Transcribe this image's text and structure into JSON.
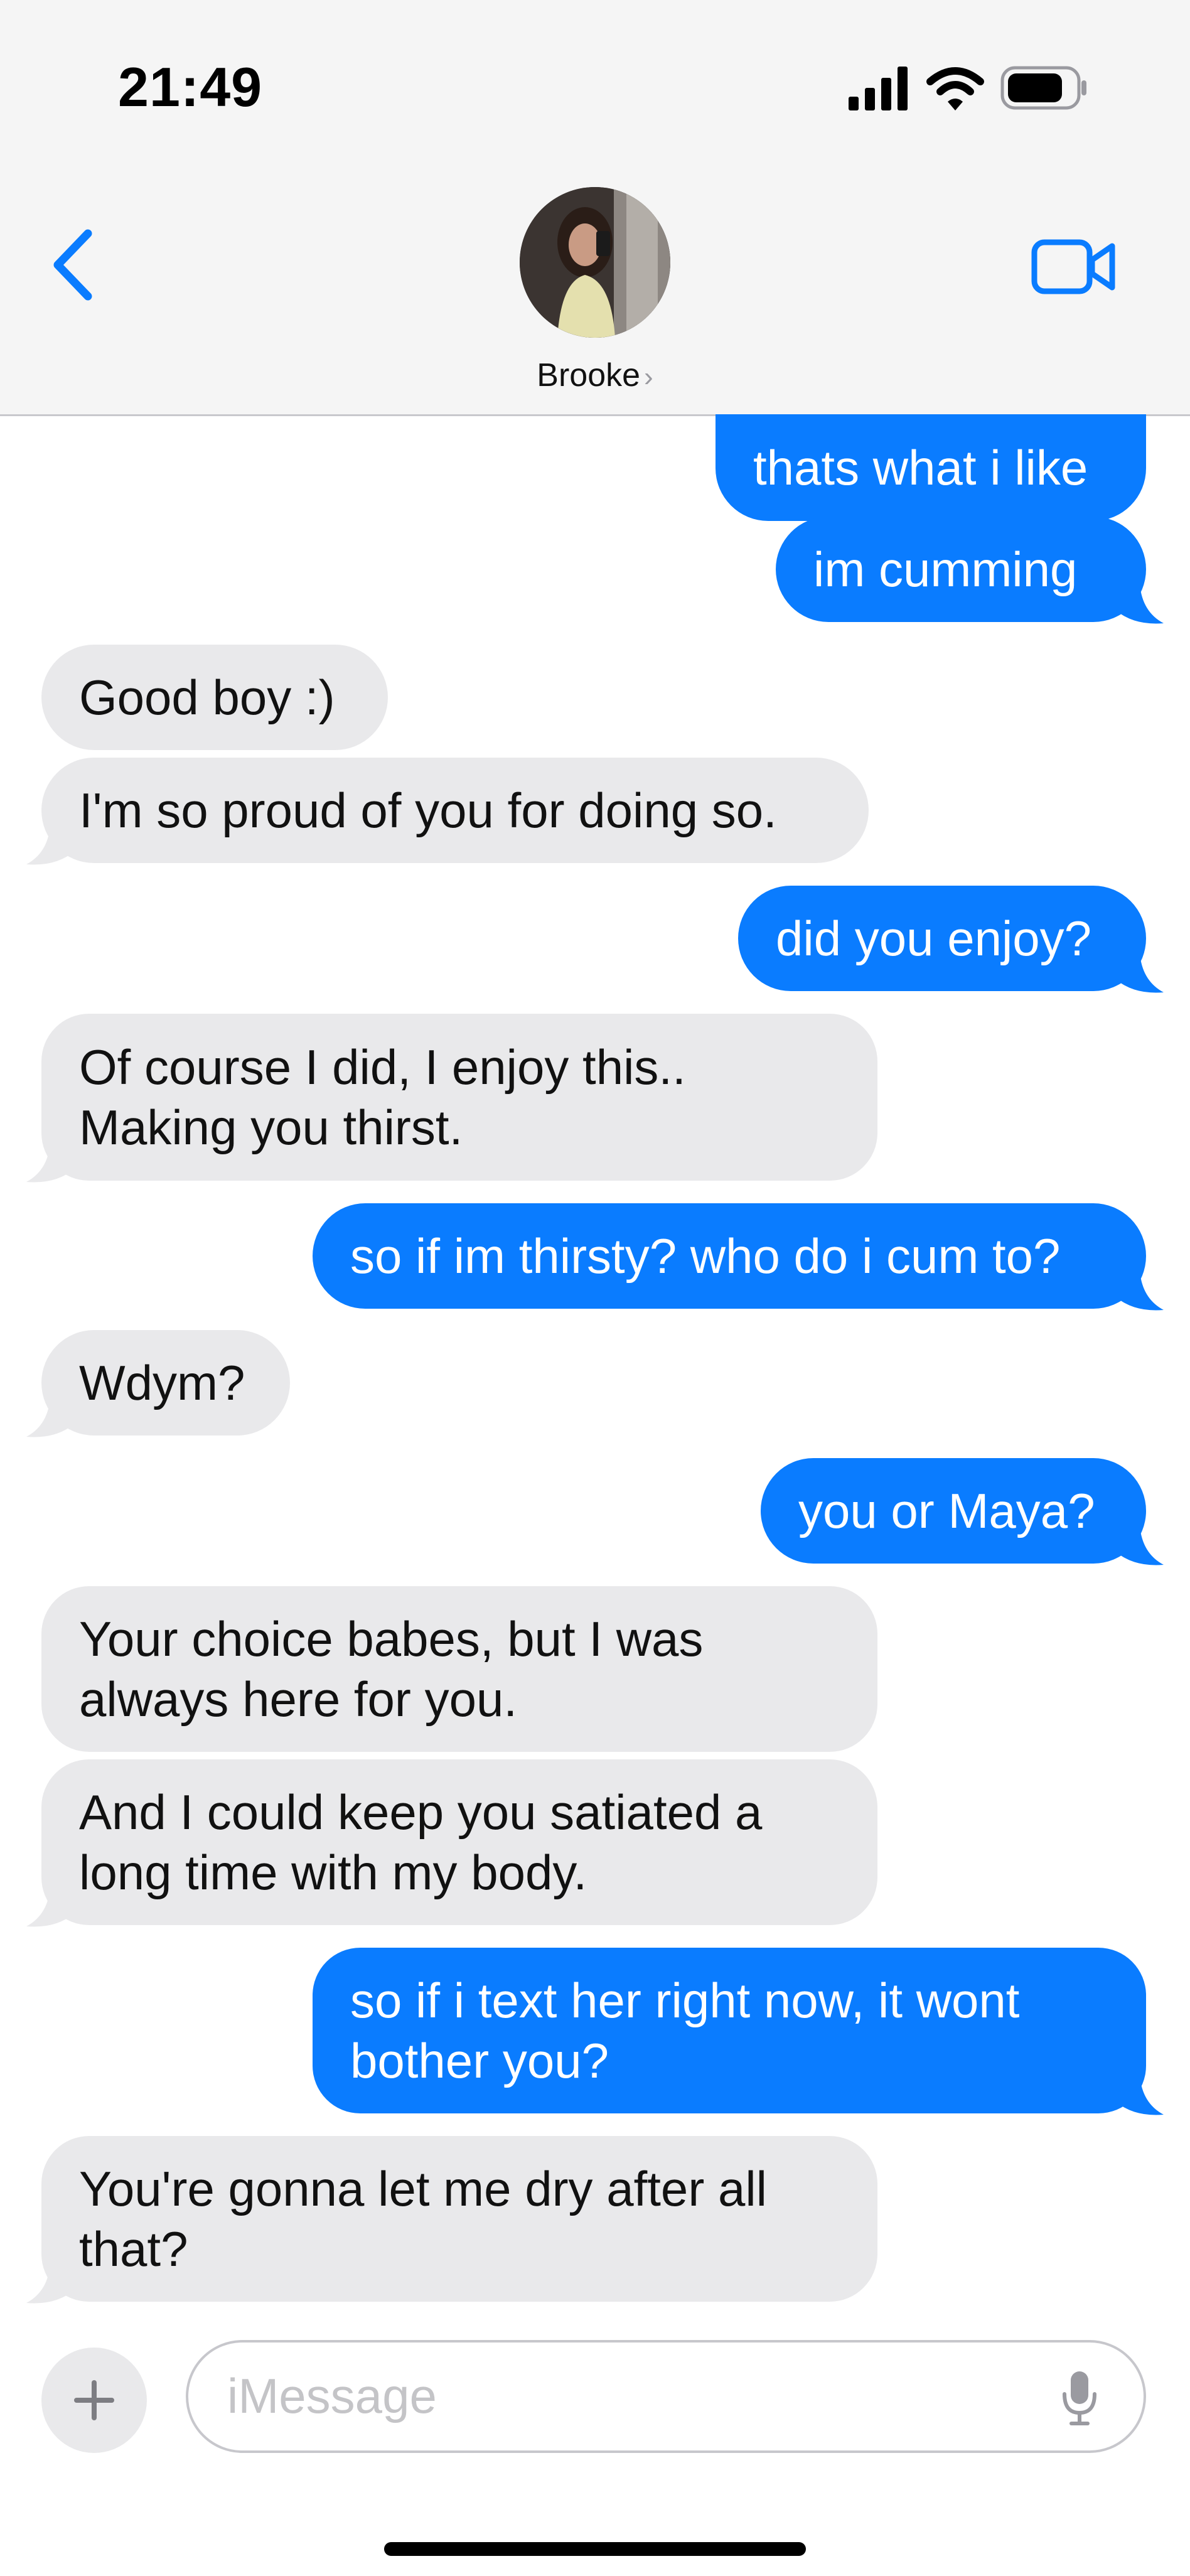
{
  "status_bar": {
    "time": "21:49"
  },
  "header": {
    "contact_name": "Brooke",
    "chevron": "›"
  },
  "icons": [
    "signal-icon",
    "wifi-icon",
    "battery-icon",
    "chevron-left-icon",
    "video-camera-icon",
    "plus-icon",
    "microphone-icon"
  ],
  "colors": {
    "outgoing": "#0a7cff",
    "incoming": "#e9e9eb",
    "accent": "#0a7cff"
  },
  "messages": [
    {
      "from": "me",
      "text": "thats what i like"
    },
    {
      "from": "me",
      "text": "im cumming"
    },
    {
      "from": "them",
      "text": "Good boy :)"
    },
    {
      "from": "them",
      "text": "I'm so proud of you for doing so."
    },
    {
      "from": "me",
      "text": "did you enjoy?"
    },
    {
      "from": "them",
      "text": "Of course I did, I enjoy this..\nMaking you thirst."
    },
    {
      "from": "me",
      "text": "so if im thirsty? who do i cum to?"
    },
    {
      "from": "them",
      "text": "Wdym?"
    },
    {
      "from": "me",
      "text": "you or Maya?"
    },
    {
      "from": "them",
      "text": "Your choice babes, but I was\nalways here for you."
    },
    {
      "from": "them",
      "text": "And I could keep you satiated a\nlong time with my body."
    },
    {
      "from": "me",
      "text": "so if i text her right now, it wont\nbother you?"
    },
    {
      "from": "them",
      "text": "You're gonna let me dry after all\nthat?"
    }
  ],
  "composer": {
    "placeholder": "iMessage"
  }
}
